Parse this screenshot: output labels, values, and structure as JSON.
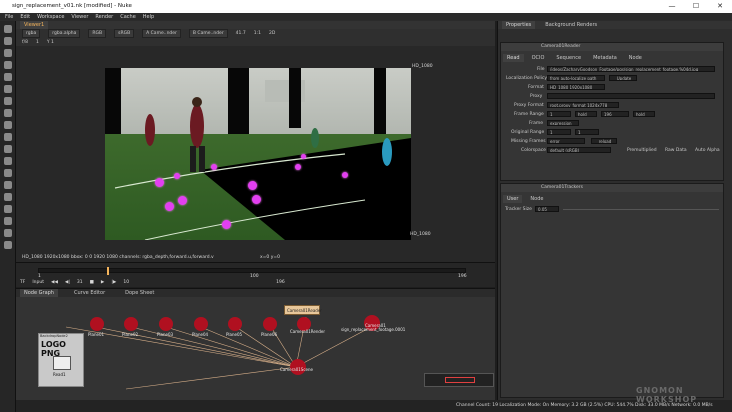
{
  "window": {
    "title": "sign_replacement_v01.nk [modified] - Nuke",
    "min": "—",
    "max": "☐",
    "close": "✕"
  },
  "menu": [
    "File",
    "Edit",
    "Workspace",
    "Viewer",
    "Render",
    "Cache",
    "Help"
  ],
  "viewer": {
    "tab": "Viewer1",
    "channels": "rgba",
    "layer": "rgba.alpha",
    "mode": "RGB",
    "colorspace": "sRGB",
    "cam_a": "A  Came..nder",
    "cam_b": "B  Came..nder",
    "frame_label": "f/8",
    "ratio": "1",
    "y_label": "Y 1",
    "zoom": "41.7",
    "fraction": "1:1",
    "mode_2d": "2D",
    "format_top": "HD_1080",
    "format_bottom": "HD_1080",
    "status_line": "HD_1080 1920x1080  bbox: 0 0 1920 1080 channels: rgba_depth,forward.u,forward.v",
    "coords": "x=0 y=0"
  },
  "timeline": {
    "fps": "TF",
    "input": "Input",
    "frame": "31",
    "frame_end": "196",
    "step": "10",
    "ticks": [
      "1",
      "100",
      "196"
    ],
    "current_pos": 0.16
  },
  "nodegraph": {
    "tabs": [
      "Node Graph",
      "Curve Editor",
      "Dope Sheet"
    ],
    "backdrop_title": "BackdropNode2",
    "backdrop_text": "LOGO PNG",
    "read_node": "Read1",
    "planes": [
      "Plane01",
      "Plane02",
      "Plane03",
      "Plane04",
      "Plane05",
      "Plane06",
      "Plane07"
    ],
    "camera_reader": "Camera01Reader",
    "camera_render": "Camera01Render",
    "camera_scene": "Camera01Scene",
    "sign_node": "sign_replacement_footage.0001",
    "camera_node": "Camera01"
  },
  "properties": {
    "tabs": [
      "Properties",
      "Background Renders"
    ],
    "reader_title": "Camera01Reader",
    "reader_tabs": [
      "Read",
      "OCIO",
      "Sequence",
      "Metadata",
      "Node"
    ],
    "file_label": "File",
    "file_value": "/ideos/ZacharyGoodson_Footage/pgs/sign_replacement_footage.%04d.jpg",
    "localization_label": "Localization Policy",
    "localization_value": "from auto-localize path",
    "update_label": "Update",
    "format_label": "Format",
    "format_value": "HD_1080 1920x1080",
    "proxy_label": "Proxy",
    "proxy_format_label": "Proxy Format",
    "proxy_format_value": "root.proxy_format 1024x778",
    "frame_range_label": "Frame Range",
    "frame_range_start": "1",
    "frame_range_hold1": "hold",
    "frame_range_end": "196",
    "frame_range_hold2": "hold",
    "frame_label": "Frame",
    "frame_value": "expression",
    "original_range_label": "Original Range",
    "original_start": "1",
    "original_end": "1",
    "missing_label": "Missing Frames",
    "missing_value": "error",
    "reload_label": "reload",
    "colorspace_label": "Colorspace",
    "colorspace_value": "default (sRGB)",
    "premultiplied": "Premultiplied",
    "raw_data": "Raw Data",
    "auto_alpha": "Auto Alpha",
    "tracker_title": "Camera01Trackers",
    "tracker_tabs": [
      "User",
      "Node"
    ],
    "tracker_size_label": "Tracker Size",
    "tracker_size_value": "0.05"
  },
  "statusbar": {
    "text": "Channel Count: 19  Localization Mode: On  Memory: 3.2 GB (2.5%)  CPU: 544.7%  Disk: 33.0 MB/s  Network: 0.0 MB/s",
    "watermark": "GNOMON WORKSHOP"
  },
  "colors": {
    "accent": "#f4b45c",
    "node_red": "#b01020",
    "tracker_dot": "#e23ff0"
  }
}
